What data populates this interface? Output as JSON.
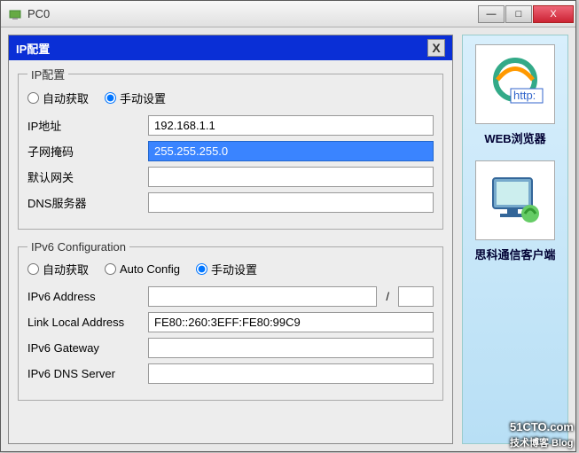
{
  "window": {
    "title": "PC0",
    "minimize": "—",
    "maximize": "□",
    "close": "X"
  },
  "panel": {
    "title": "IP配置",
    "close": "X"
  },
  "ipv4": {
    "legend": "IP配置",
    "mode_auto": "自动获取",
    "mode_manual": "手动设置",
    "ip_label": "IP地址",
    "ip_value": "192.168.1.1",
    "mask_label": "子网掩码",
    "mask_value": "255.255.255.0",
    "gateway_label": "默认网关",
    "gateway_value": "",
    "dns_label": "DNS服务器",
    "dns_value": ""
  },
  "ipv6": {
    "legend": "IPv6 Configuration",
    "mode_auto": "自动获取",
    "mode_autoconfig": "Auto Config",
    "mode_manual": "手动设置",
    "addr_label": "IPv6 Address",
    "addr_value": "",
    "prefix_value": "",
    "linklocal_label": "Link Local Address",
    "linklocal_value": "FE80::260:3EFF:FE80:99C9",
    "gateway_label": "IPv6 Gateway",
    "gateway_value": "",
    "dns_label": "IPv6 DNS Server",
    "dns_value": ""
  },
  "sidebar": {
    "web_label": "WEB浏览器",
    "client_label": "思科通信客户端"
  },
  "watermark": {
    "main": "51CTO.com",
    "sub": "技术博客        Blog"
  }
}
